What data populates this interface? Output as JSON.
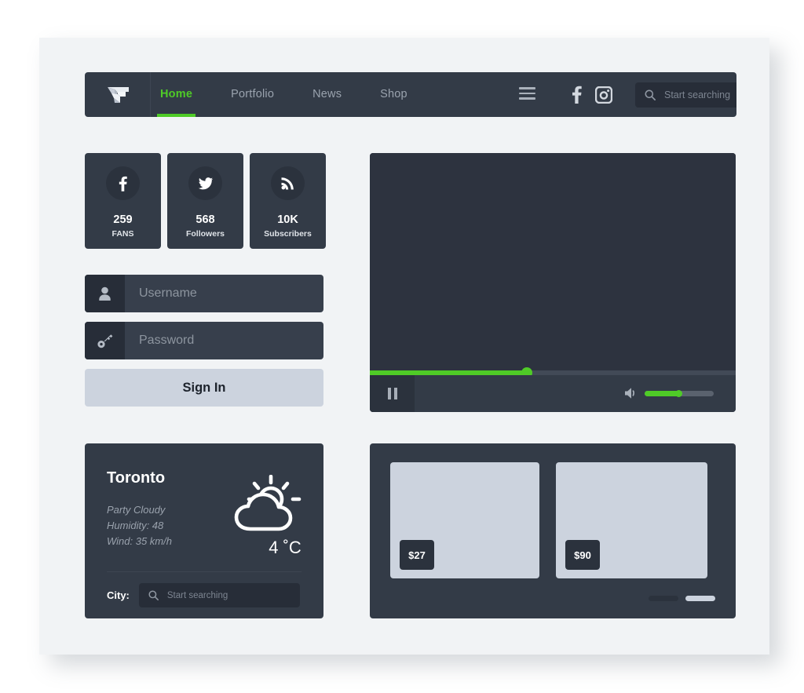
{
  "theme": {
    "accent_green": "#4fcb27",
    "panel_dark": "#333b47",
    "panel_darker": "#272d38",
    "screen_dark": "#2d333f",
    "light_surface": "#ccd3de",
    "page_bg": "#f1f3f5",
    "muted_text": "#9aa2ad"
  },
  "navbar": {
    "logo_icon": "origami-f-logo-icon",
    "links": [
      {
        "label": "Home",
        "active": true
      },
      {
        "label": "Portfolio",
        "active": false
      },
      {
        "label": "News",
        "active": false
      },
      {
        "label": "Shop",
        "active": false
      }
    ],
    "hamburger_icon": "hamburger-menu-icon",
    "social": [
      {
        "name": "facebook-icon"
      },
      {
        "name": "instagram-icon"
      }
    ],
    "search": {
      "icon": "search-icon",
      "placeholder": "Start searching",
      "value": ""
    }
  },
  "stats": [
    {
      "icon": "facebook-icon",
      "value": "259",
      "label": "FANS"
    },
    {
      "icon": "twitter-icon",
      "value": "568",
      "label": "Followers"
    },
    {
      "icon": "rss-icon",
      "value": "10K",
      "label": "Subscribers"
    }
  ],
  "login": {
    "username": {
      "icon": "user-icon",
      "placeholder": "Username",
      "value": ""
    },
    "password": {
      "icon": "key-icon",
      "placeholder": "Password",
      "value": ""
    },
    "submit_label": "Sign In"
  },
  "weather": {
    "city": "Toronto",
    "condition": "Party Cloudy",
    "humidity": "Humidity: 48",
    "wind": "Wind: 35 km/h",
    "temperature": "4 ˚C",
    "icon": "sun-behind-cloud-icon",
    "city_field_label": "City:",
    "search": {
      "icon": "search-icon",
      "placeholder": "Start searching",
      "value": ""
    }
  },
  "player": {
    "pause_icon": "pause-icon",
    "volume_icon": "speaker-icon",
    "progress_percent": 43,
    "volume_percent": 50
  },
  "gallery": {
    "items": [
      {
        "price": "$27"
      },
      {
        "price": "$90"
      }
    ],
    "pager": [
      {
        "active": false
      },
      {
        "active": true
      }
    ]
  }
}
